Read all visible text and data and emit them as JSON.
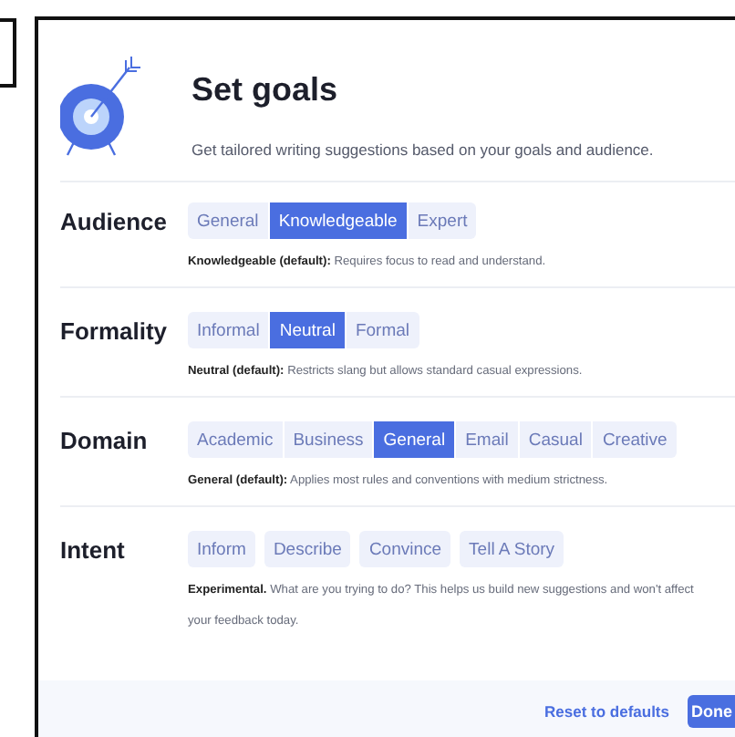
{
  "dialog": {
    "title": "Set goals",
    "subtitle": "Get tailored writing suggestions based on your goals and audience.",
    "sections": [
      {
        "label": "Audience",
        "kind": "segmented",
        "options": [
          {
            "label": "General",
            "selected": false
          },
          {
            "label": "Knowledgeable",
            "selected": true
          },
          {
            "label": "Expert",
            "selected": false
          }
        ],
        "description": [
          "**Knowledgeable (default):** Requires focus to read and understand."
        ]
      },
      {
        "label": "Formality",
        "kind": "segmented",
        "options": [
          {
            "label": "Informal",
            "selected": false
          },
          {
            "label": "Neutral",
            "selected": true
          },
          {
            "label": "Formal",
            "selected": false
          }
        ],
        "description": [
          "**Neutral (default):** Restricts slang but allows standard casual expressions."
        ]
      },
      {
        "label": "Domain",
        "kind": "segmented",
        "options": [
          {
            "label": "Academic",
            "selected": false
          },
          {
            "label": "Business",
            "selected": false
          },
          {
            "label": "General",
            "selected": true
          },
          {
            "label": "Email",
            "selected": false
          },
          {
            "label": "Casual",
            "selected": false
          },
          {
            "label": "Creative",
            "selected": false
          }
        ],
        "description": [
          "**General (default):** Applies most rules and conventions with medium strictness."
        ]
      },
      {
        "label": "Intent",
        "kind": "chips",
        "options": [
          {
            "label": "Inform",
            "selected": false
          },
          {
            "label": "Describe",
            "selected": false
          },
          {
            "label": "Convince",
            "selected": false
          },
          {
            "label": "Tell A Story",
            "selected": false
          }
        ],
        "description": [
          "**Experimental.** What are you trying to do? This helps us build new suggestions and won't affect",
          "your feedback today."
        ]
      }
    ],
    "footer": {
      "reset": "Reset to defaults",
      "done": "Done"
    }
  }
}
